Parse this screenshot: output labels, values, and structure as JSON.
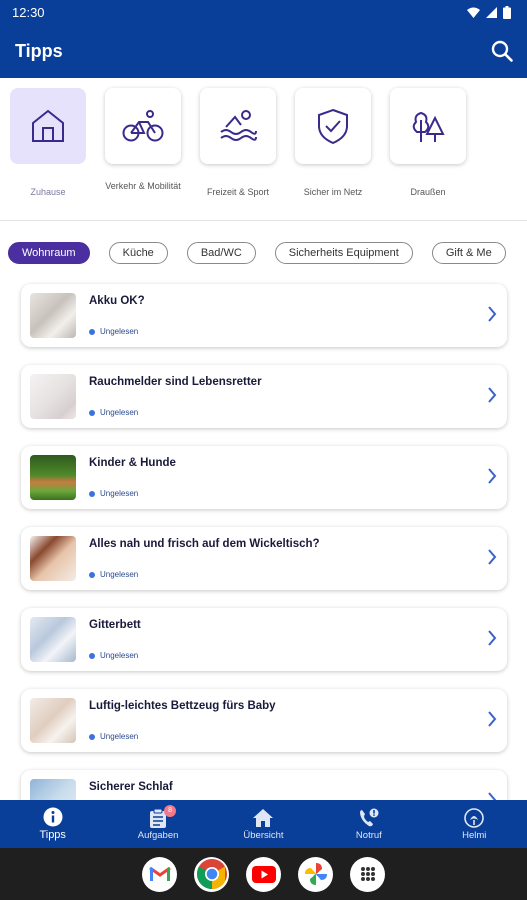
{
  "status": {
    "time": "12:30"
  },
  "appbar": {
    "title": "Tipps"
  },
  "categories": [
    {
      "label": "Zuhause",
      "icon": "house-icon",
      "active": true
    },
    {
      "label": "Verkehr & Mobilität",
      "icon": "bicycle-icon"
    },
    {
      "label": "Freizeit & Sport",
      "icon": "swimmer-icon"
    },
    {
      "label": "Sicher im Netz",
      "icon": "shield-icon"
    },
    {
      "label": "Draußen",
      "icon": "trees-icon"
    }
  ],
  "chips": [
    "Wohnraum",
    "Küche",
    "Bad/WC",
    "Sicherheits Equipment",
    "Gift & Me"
  ],
  "items": [
    {
      "title": "Akku OK?",
      "status": "Ungelesen"
    },
    {
      "title": "Rauchmelder sind Lebensretter",
      "status": "Ungelesen"
    },
    {
      "title": "Kinder & Hunde",
      "status": "Ungelesen"
    },
    {
      "title": "Alles nah und frisch auf dem Wickeltisch?",
      "status": "Ungelesen"
    },
    {
      "title": "Gitterbett",
      "status": "Ungelesen"
    },
    {
      "title": "Luftig-leichtes Bettzeug fürs Baby",
      "status": "Ungelesen"
    },
    {
      "title": "Sicherer Schlaf",
      "status": ""
    }
  ],
  "bottom_nav": [
    {
      "label": "Tipps",
      "icon": "info-icon",
      "active": true
    },
    {
      "label": "Aufgaben",
      "icon": "clipboard-icon",
      "badge": "8"
    },
    {
      "label": "Übersicht",
      "icon": "home-icon"
    },
    {
      "label": "Notruf",
      "icon": "phone-icon"
    },
    {
      "label": "Helmi",
      "icon": "helmi-icon"
    }
  ],
  "dock_apps": [
    "gmail-icon",
    "chrome-icon",
    "youtube-icon",
    "photos-icon",
    "apps-icon"
  ],
  "colors": {
    "primary": "#0a3f99",
    "accent": "#4b2fa0",
    "icon": "#3b2a8c",
    "unread_dot": "#3a72e0",
    "chevron": "#3a62c9"
  }
}
